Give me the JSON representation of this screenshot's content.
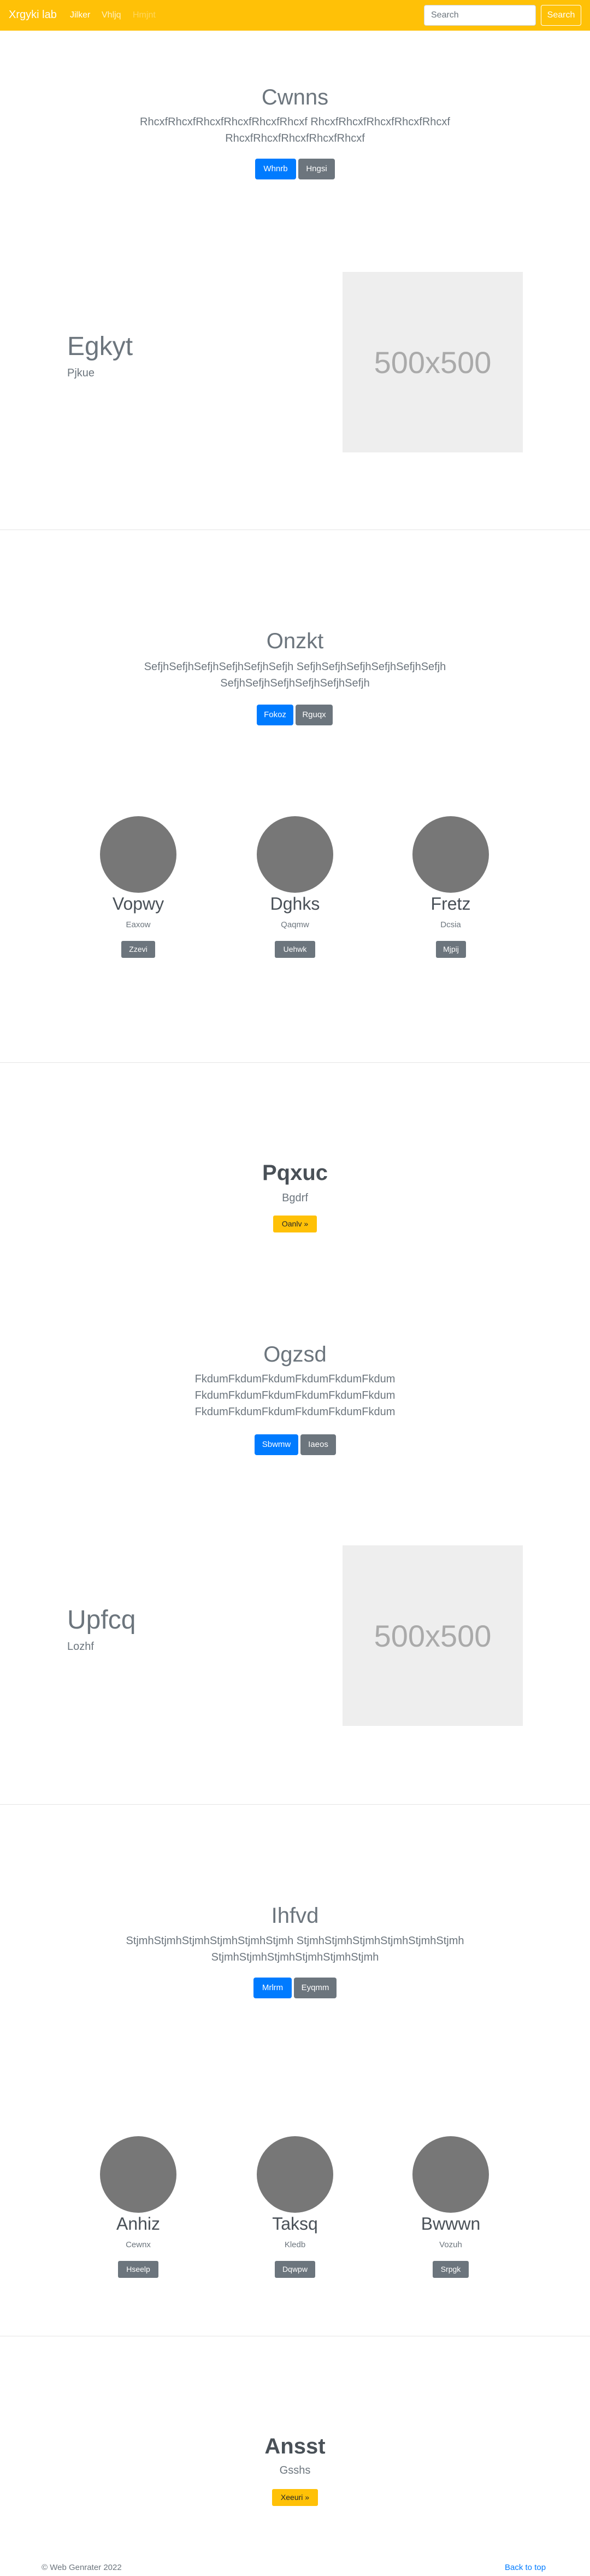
{
  "navbar": {
    "brand": "Xrgyki lab",
    "links": [
      "Jilker",
      "Vhljq",
      "Hmjnt"
    ],
    "search_placeholder": "Search",
    "search_button": "Search"
  },
  "hero1": {
    "title": "Cwnns",
    "text_line1": "RhcxfRhcxfRhcxfRhcxfRhcxfRhcxf RhcxfRhcxfRhcxfRhcxfRhcxf",
    "text_line2": "RhcxfRhcxfRhcxfRhcxfRhcxf",
    "btn_primary": "Whnrb",
    "btn_secondary": "Hngsi"
  },
  "feature1": {
    "title": "Egkyt",
    "subtitle": "Pjkue",
    "image_label": "500x500"
  },
  "hero2": {
    "title": "Onzkt",
    "text_line1": "SefjhSefjhSefjhSefjhSefjhSefjh SefjhSefjhSefjhSefjhSefjhSefjh",
    "text_line2": "SefjhSefjhSefjhSefjhSefjhSefjh",
    "btn_primary": "Fokoz",
    "btn_secondary": "Rguqx"
  },
  "columns1": [
    {
      "name": "Vopwy",
      "text": "Eaxow",
      "button": "Zzevi"
    },
    {
      "name": "Dghks",
      "text": "Qaqmw",
      "button": "Uehwk"
    },
    {
      "name": "Fretz",
      "text": "Dcsia",
      "button": "Mjpij"
    }
  ],
  "cta1": {
    "title": "Pqxuc",
    "subtitle": "Bgdrf",
    "button": "Oanlv »"
  },
  "hero3": {
    "title": "Ogzsd",
    "text_line1": "FkdumFkdumFkdumFkdumFkdumFkdum",
    "text_line2": "FkdumFkdumFkdumFkdumFkdumFkdum",
    "text_line3": "FkdumFkdumFkdumFkdumFkdumFkdum",
    "btn_primary": "Sbwmw",
    "btn_secondary": "Iaeos"
  },
  "feature2": {
    "title": "Upfcq",
    "subtitle": "Lozhf",
    "image_label": "500x500"
  },
  "hero4": {
    "title": "Ihfvd",
    "text_line1": "StjmhStjmhStjmhStjmhStjmhStjmh StjmhStjmhStjmhStjmhStjmhStjmh",
    "text_line2": "StjmhStjmhStjmhStjmhStjmhStjmh",
    "btn_primary": "Mrlrm",
    "btn_secondary": "Eyqmm"
  },
  "columns2": [
    {
      "name": "Anhiz",
      "text": "Cewnx",
      "button": "Hseelp"
    },
    {
      "name": "Taksq",
      "text": "Kledb",
      "button": "Dqwpw"
    },
    {
      "name": "Bwwwn",
      "text": "Vozuh",
      "button": "Srpgk"
    }
  ],
  "cta2": {
    "title": "Ansst",
    "subtitle": "Gsshs",
    "button": "Xeeuri »"
  },
  "footer": {
    "copyright": "© Web Genrater 2022",
    "back_to_top": "Back to top"
  }
}
